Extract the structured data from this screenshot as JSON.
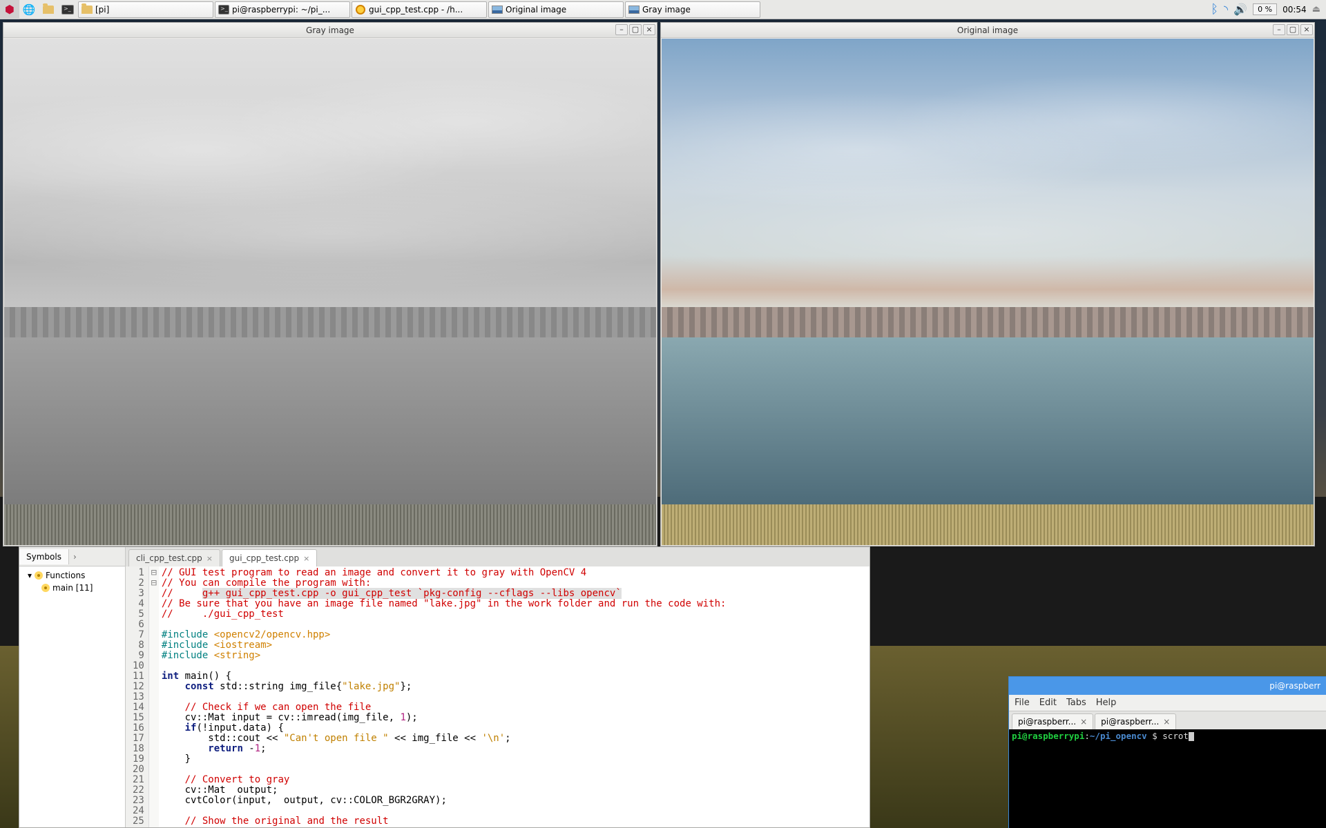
{
  "taskbar": {
    "tasks": [
      {
        "label": "[pi]",
        "icon": "folder"
      },
      {
        "label": "pi@raspberrypi: ~/pi_...",
        "icon": "term"
      },
      {
        "label": "gui_cpp_test.cpp - /h...",
        "icon": "geany"
      },
      {
        "label": "Original image",
        "icon": "img"
      },
      {
        "label": "Gray image",
        "icon": "img"
      }
    ],
    "cpu_badge": "0 %",
    "clock": "00:54"
  },
  "win_gray": {
    "title": "Gray image"
  },
  "win_orig": {
    "title": "Original image"
  },
  "editor": {
    "symbols_tab": "Symbols",
    "tree": {
      "functions": "Functions",
      "main": "main [11]"
    },
    "tabs": [
      {
        "name": "cli_cpp_test.cpp",
        "active": false
      },
      {
        "name": "gui_cpp_test.cpp",
        "active": true
      }
    ],
    "lines": [
      {
        "n": 1,
        "seg": [
          [
            "com",
            "// GUI test program to read an image and convert it to gray with OpenCV 4"
          ]
        ]
      },
      {
        "n": 2,
        "seg": [
          [
            "com",
            "// You can compile the program with:"
          ]
        ]
      },
      {
        "n": 3,
        "seg": [
          [
            "com",
            "//     "
          ],
          [
            "comhl",
            "g++ gui_cpp_test.cpp -o gui_cpp_test `pkg-config --cflags --libs opencv`"
          ]
        ]
      },
      {
        "n": 4,
        "seg": [
          [
            "com",
            "// Be sure that you have an image file named \"lake.jpg\" in the work folder and run the code with:"
          ]
        ]
      },
      {
        "n": 5,
        "seg": [
          [
            "com",
            "//     ./gui_cpp_test"
          ]
        ]
      },
      {
        "n": 6,
        "seg": []
      },
      {
        "n": 7,
        "seg": [
          [
            "pre",
            "#include "
          ],
          [
            "inc",
            "<opencv2/opencv.hpp>"
          ]
        ]
      },
      {
        "n": 8,
        "seg": [
          [
            "pre",
            "#include "
          ],
          [
            "inc",
            "<iostream>"
          ]
        ]
      },
      {
        "n": 9,
        "seg": [
          [
            "pre",
            "#include "
          ],
          [
            "inc",
            "<string>"
          ]
        ]
      },
      {
        "n": 10,
        "seg": []
      },
      {
        "n": 11,
        "fold": "-",
        "seg": [
          [
            "kw",
            "int"
          ],
          [
            "",
            " main"
          ],
          [
            "",
            "() {"
          ]
        ]
      },
      {
        "n": 12,
        "seg": [
          [
            "",
            "    "
          ],
          [
            "kw",
            "const"
          ],
          [
            "",
            " std::string img_file{"
          ],
          [
            "str",
            "\"lake.jpg\""
          ],
          [
            "",
            "};"
          ]
        ]
      },
      {
        "n": 13,
        "seg": []
      },
      {
        "n": 14,
        "seg": [
          [
            "",
            "    "
          ],
          [
            "com",
            "// Check if we can open the file"
          ]
        ]
      },
      {
        "n": 15,
        "seg": [
          [
            "",
            "    cv::Mat input = cv::imread(img_file, "
          ],
          [
            "num",
            "1"
          ],
          [
            "",
            ");"
          ]
        ]
      },
      {
        "n": 16,
        "fold": "-",
        "seg": [
          [
            "",
            "    "
          ],
          [
            "kw",
            "if"
          ],
          [
            "",
            "(!input.data) {"
          ]
        ]
      },
      {
        "n": 17,
        "seg": [
          [
            "",
            "        std::cout << "
          ],
          [
            "str",
            "\"Can't open file \""
          ],
          [
            "",
            " << img_file << "
          ],
          [
            "str",
            "'\\n'"
          ],
          [
            "",
            ";"
          ]
        ]
      },
      {
        "n": 18,
        "seg": [
          [
            "",
            "        "
          ],
          [
            "kw",
            "return"
          ],
          [
            "",
            " -"
          ],
          [
            "num",
            "1"
          ],
          [
            "",
            ";"
          ]
        ]
      },
      {
        "n": 19,
        "seg": [
          [
            "",
            "    }"
          ]
        ]
      },
      {
        "n": 20,
        "seg": []
      },
      {
        "n": 21,
        "seg": [
          [
            "",
            "    "
          ],
          [
            "com",
            "// Convert to gray"
          ]
        ]
      },
      {
        "n": 22,
        "seg": [
          [
            "",
            "    cv::Mat  output;"
          ]
        ]
      },
      {
        "n": 23,
        "seg": [
          [
            "",
            "    cvtColor(input,  output, cv::COLOR_BGR2GRAY);"
          ]
        ]
      },
      {
        "n": 24,
        "seg": []
      },
      {
        "n": 25,
        "seg": [
          [
            "",
            "    "
          ],
          [
            "com",
            "// Show the original and the result"
          ]
        ]
      }
    ]
  },
  "terminal": {
    "title": "pi@raspberr",
    "menu": [
      "File",
      "Edit",
      "Tabs",
      "Help"
    ],
    "tabs": [
      "pi@raspberr...",
      "pi@raspberr..."
    ],
    "prompt_user": "pi@raspberrypi",
    "prompt_sep1": ":",
    "prompt_path": "~/pi_opencv",
    "prompt_sep2": " $ ",
    "cmd": "scrot"
  }
}
